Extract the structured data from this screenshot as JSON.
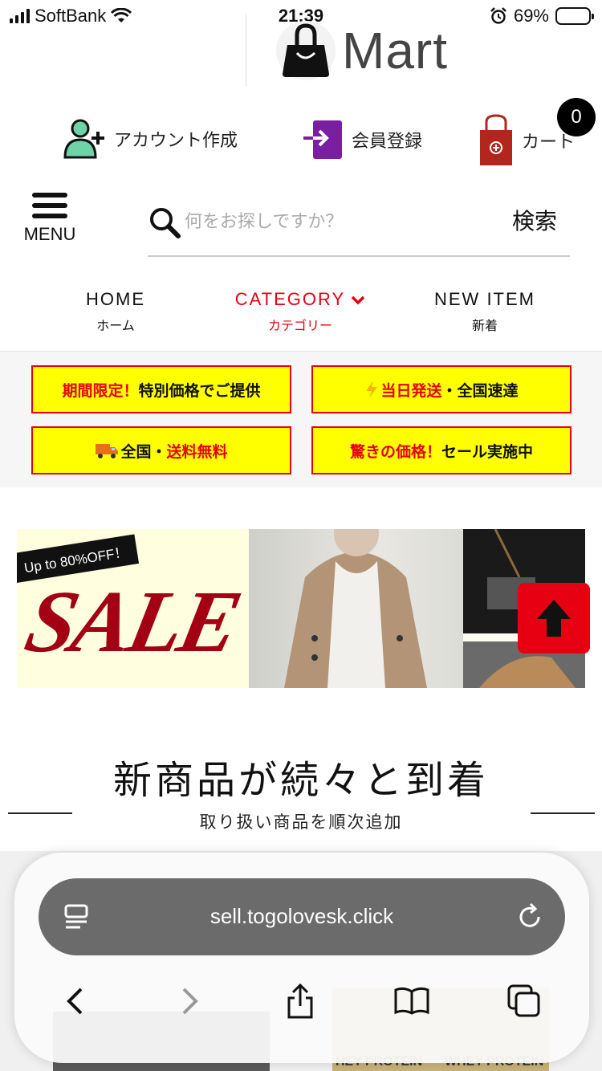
{
  "status_bar": {
    "carrier": "SoftBank",
    "time": "21:39",
    "battery": "69%",
    "battery_level": 0.69
  },
  "logo": {
    "text": "Mart"
  },
  "account": {
    "create_label": "アカウント作成",
    "register_label": "会員登録",
    "cart_label": "カート",
    "cart_count": "0"
  },
  "menu": {
    "label": "MENU"
  },
  "search": {
    "placeholder": "何をお探しですか？",
    "button_label": "検索"
  },
  "nav": {
    "items": [
      {
        "en": "HOME",
        "jp": "ホーム"
      },
      {
        "en": "CATEGORY",
        "jp": "カテゴリー"
      },
      {
        "en": "NEW ITEM",
        "jp": "新着"
      }
    ],
    "active_color": "#e60012"
  },
  "promos": [
    {
      "red": "期間限定！",
      "black": "特別価格でご提供"
    },
    {
      "red": "当日発送",
      "black": "・全国速達"
    },
    {
      "black": "全国・",
      "red": "送料無料"
    },
    {
      "red": "驚きの価格！",
      "black": "セール実施中"
    }
  ],
  "banner": {
    "tag": "Up to 80%OFF！",
    "word": "SALE"
  },
  "section": {
    "title": "新商品が続々と到着",
    "subtitle": "取り扱い商品を順次追加"
  },
  "product_peek": {
    "label_1": "HEY PROTEIN",
    "label_2": "WHEY PROTEIN"
  },
  "browser": {
    "url": "sell.togolovesk.click"
  },
  "colors": {
    "accent_red": "#e60012",
    "promo_yellow": "#ffff00",
    "register_purple": "#7b1fa2",
    "account_green": "#6fd3a8",
    "cart_brown": "#b3261e"
  }
}
